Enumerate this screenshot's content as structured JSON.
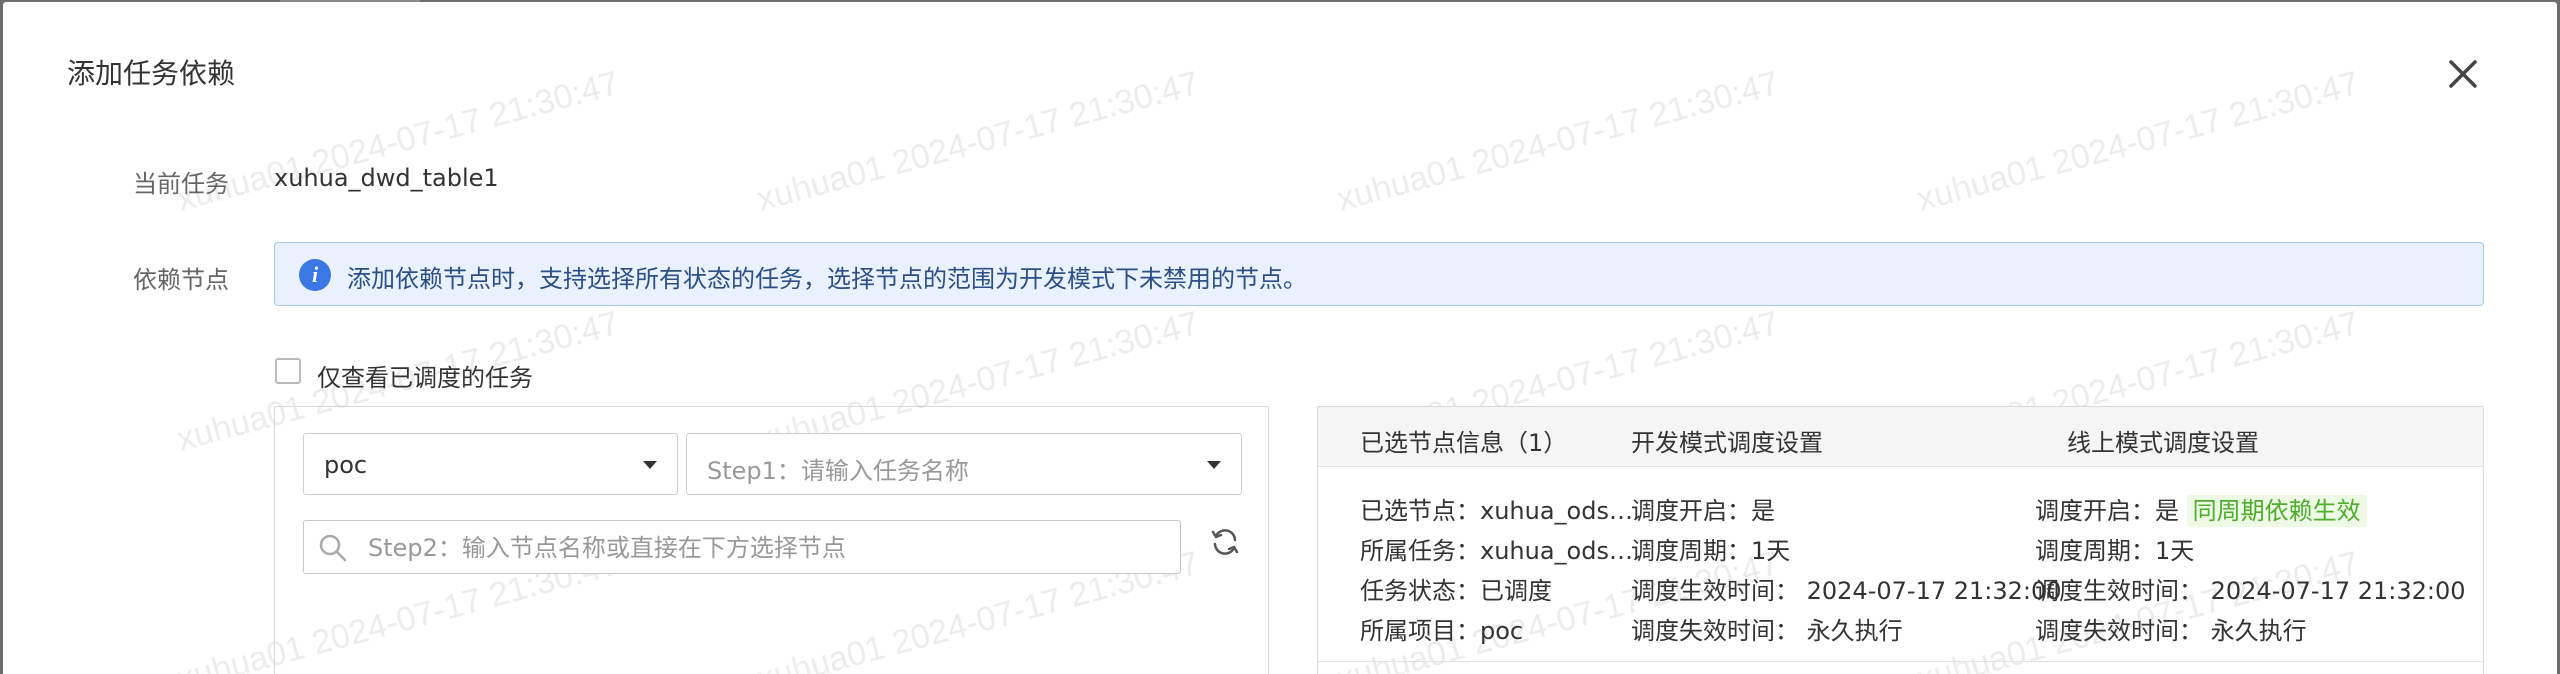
{
  "dialog": {
    "title": "添加任务依赖",
    "current_task_label": "当前任务",
    "current_task_value": "xuhua_dwd_table1",
    "dependency_label": "依赖节点",
    "alert_text": "添加依赖节点时，支持选择所有状态的任务，选择节点的范围为开发模式下未禁用的节点。",
    "checkbox_label": "仅查看已调度的任务"
  },
  "left_panel": {
    "project_select_value": "poc",
    "task_select_placeholder": "Step1：请输入任务名称",
    "node_search_placeholder": "Step2：输入节点名称或直接在下方选择节点"
  },
  "right_panel": {
    "headers": [
      "已选节点信息（1）",
      "开发模式调度设置",
      "线上模式调度设置"
    ],
    "selected": {
      "node": "已选节点：xuhua_ods…",
      "task": "所属任务：xuhua_ods…",
      "status": "任务状态：已调度",
      "project": "所属项目：poc"
    },
    "dev": {
      "enabled": "调度开启：是",
      "cycle": "调度周期：1天",
      "start": "调度生效时间： 2024-07-17 21:32:00",
      "end": "调度失效时间： 永久执行"
    },
    "online": {
      "enabled": "调度开启：是",
      "badge": "同周期依赖生效",
      "cycle": "调度周期：1天",
      "start": "调度生效时间： 2024-07-17 21:32:00",
      "end": "调度失效时间： 永久执行"
    }
  },
  "watermark_text": "xuhua01 2024-07-17 21:30:47",
  "colors": {
    "alert_bg": "#e8f1fd",
    "alert_border": "#a8c8f5",
    "info_blue": "#3a78e5",
    "badge_green": "#4cae2b",
    "badge_bg": "#eef9e6"
  }
}
